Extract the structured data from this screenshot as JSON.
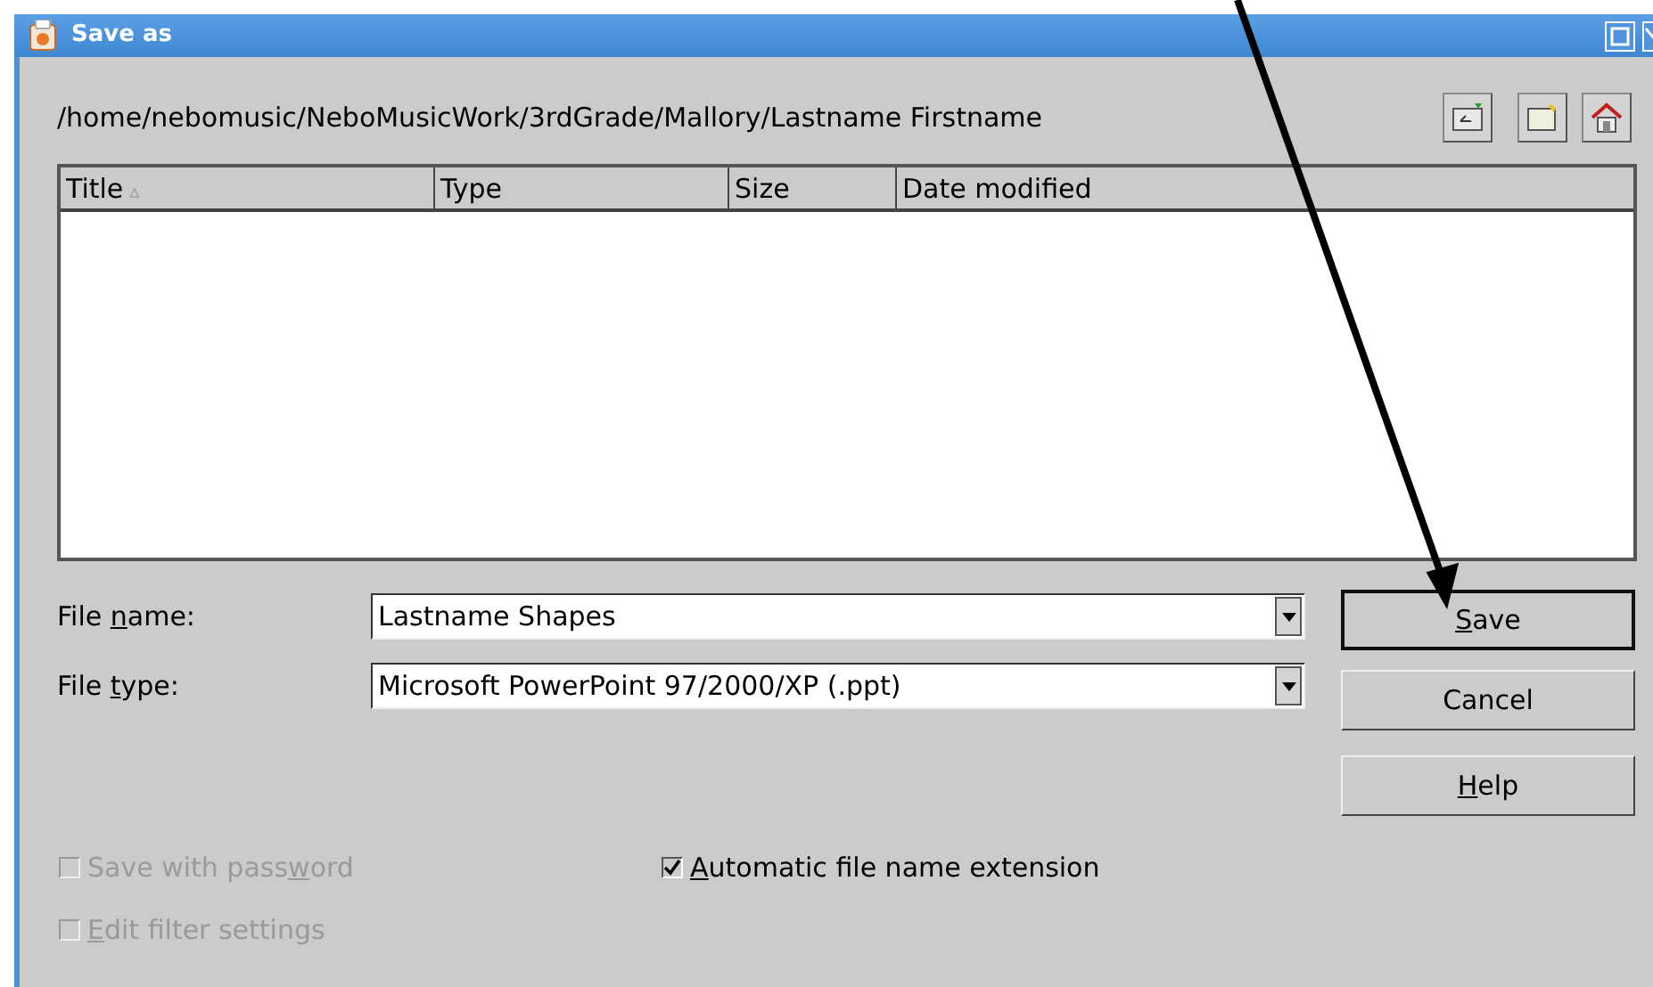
{
  "window": {
    "title": "Save as"
  },
  "path": "/home/nebomusic/NeboMusicWork/3rdGrade/Mallory/Lastname Firstname",
  "toolbar": [
    {
      "kind": "up"
    },
    {
      "kind": "new-folder"
    },
    {
      "kind": "home"
    }
  ],
  "file_list": {
    "columns": [
      {
        "label": "Title",
        "sort": "▵"
      },
      {
        "label": "Type"
      },
      {
        "label": "Size"
      },
      {
        "label": "Date modified"
      }
    ]
  },
  "fields": [
    {
      "label": [
        {
          "text": "File "
        },
        {
          "text": "n",
          "underline": true
        },
        {
          "text": "ame:"
        }
      ],
      "value": "Lastname Shapes"
    },
    {
      "label": [
        {
          "text": "File "
        },
        {
          "text": "t",
          "underline": true
        },
        {
          "text": "ype:"
        }
      ],
      "value": "Microsoft PowerPoint 97/2000/XP (.ppt)"
    }
  ],
  "buttons": [
    {
      "label": [
        {
          "text": "S",
          "underline": true
        },
        {
          "text": "ave"
        }
      ],
      "default": true
    },
    {
      "label": [
        {
          "text": "Cancel"
        }
      ],
      "default": false
    },
    {
      "label": [
        {
          "text": "H",
          "underline": true
        },
        {
          "text": "elp"
        }
      ],
      "default": false
    }
  ],
  "options": [
    {
      "label": [
        {
          "text": "Save with pass"
        },
        {
          "text": "w",
          "underline": true
        },
        {
          "text": "ord"
        }
      ],
      "checked": false,
      "disabled": true
    },
    {
      "label": [
        {
          "text": "A",
          "underline": true
        },
        {
          "text": "utomatic file name extension"
        }
      ],
      "checked": true,
      "disabled": false
    },
    {
      "label": [
        {
          "text": "E",
          "underline": true
        },
        {
          "text": "dit filter settings"
        }
      ],
      "checked": false,
      "disabled": true
    }
  ],
  "annotation": {
    "kind": "arrow"
  }
}
